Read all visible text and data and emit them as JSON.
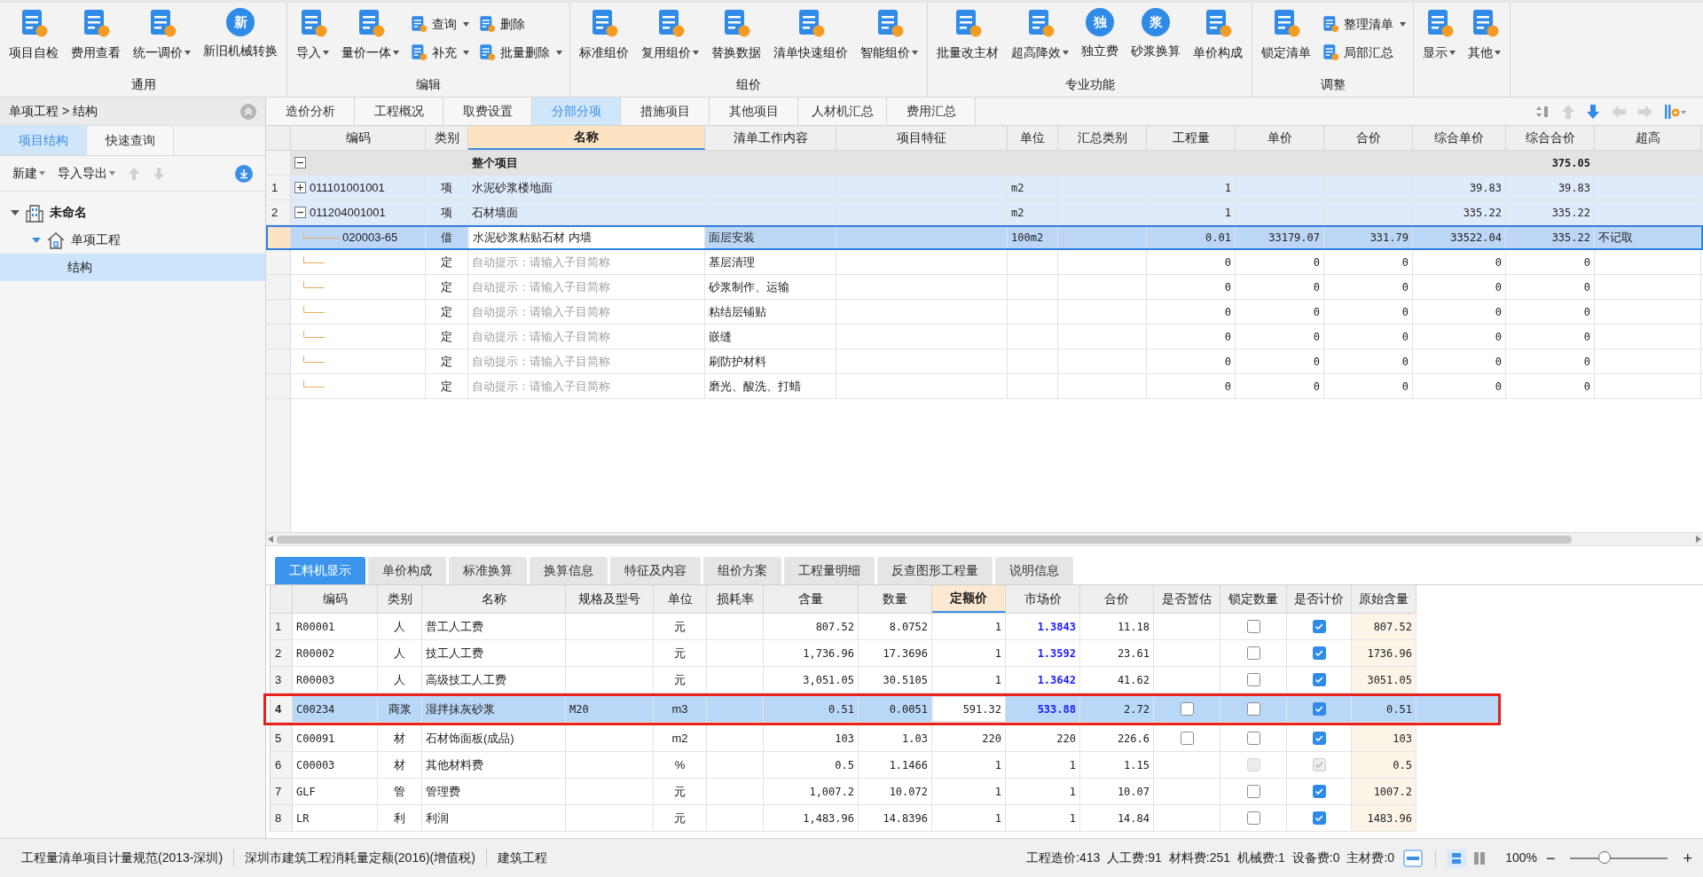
{
  "ribbon": {
    "groups": [
      {
        "label": "通用",
        "columns": [
          [
            {
              "label": "项目自检",
              "dropdown": false
            }
          ],
          [
            {
              "label": "费用查看",
              "dropdown": false
            }
          ],
          [
            {
              "label": "统一调价",
              "dropdown": true
            }
          ],
          [
            {
              "label": "新旧机械转换",
              "dropdown": false,
              "glyph": "新"
            }
          ]
        ]
      },
      {
        "label": "编辑",
        "columns": [
          [
            {
              "label": "导入",
              "dropdown": true
            }
          ],
          [
            {
              "label": "量价一体",
              "dropdown": true
            }
          ],
          [
            {
              "label": "查询",
              "dropdown": true
            },
            {
              "label": "补充",
              "dropdown": true
            }
          ],
          [
            {
              "label": "删除",
              "dropdown": false
            },
            {
              "label": "批量删除",
              "dropdown": true
            }
          ]
        ]
      },
      {
        "label": "组价",
        "columns": [
          [
            {
              "label": "标准组价",
              "dropdown": false
            }
          ],
          [
            {
              "label": "复用组价",
              "dropdown": true
            }
          ],
          [
            {
              "label": "替换数据",
              "dropdown": false
            }
          ],
          [
            {
              "label": "清单快速组价",
              "dropdown": false
            }
          ],
          [
            {
              "label": "智能组价",
              "dropdown": true
            }
          ]
        ]
      },
      {
        "label": "专业功能",
        "columns": [
          [
            {
              "label": "批量改主材",
              "dropdown": false
            }
          ],
          [
            {
              "label": "超高降效",
              "dropdown": true
            }
          ],
          [
            {
              "label": "独立费",
              "dropdown": false,
              "glyph": "独"
            }
          ],
          [
            {
              "label": "砂浆换算",
              "dropdown": false,
              "glyph": "浆"
            }
          ],
          [
            {
              "label": "单价构成",
              "dropdown": false
            }
          ]
        ]
      },
      {
        "label": "调整",
        "columns": [
          [
            {
              "label": "锁定清单",
              "dropdown": false
            }
          ],
          [
            {
              "label": "整理清单",
              "dropdown": true
            },
            {
              "label": "局部汇总",
              "dropdown": false
            }
          ]
        ]
      },
      {
        "columns": [
          [
            {
              "label": "显示",
              "dropdown": true
            }
          ],
          [
            {
              "label": "其他",
              "dropdown": true
            }
          ]
        ]
      }
    ]
  },
  "sidebar": {
    "breadcrumb": "单项工程 > 结构",
    "tabs": [
      {
        "label": "项目结构",
        "selected": true
      },
      {
        "label": "快速查询",
        "selected": false
      }
    ],
    "toolbar": [
      {
        "label": "新建",
        "dropdown": true
      },
      {
        "label": "导入导出",
        "dropdown": true
      }
    ],
    "tree": [
      {
        "label": "未命名",
        "kind": "project",
        "expanded": true,
        "selected": false,
        "children": [
          {
            "label": "单项工程",
            "kind": "unit",
            "expanded": true,
            "selected": false,
            "children": [
              {
                "label": "结构",
                "kind": "part",
                "selected": true
              }
            ]
          }
        ]
      }
    ]
  },
  "main_tabs": [
    {
      "label": "造价分析",
      "selected": false
    },
    {
      "label": "工程概况",
      "selected": false
    },
    {
      "label": "取费设置",
      "selected": false
    },
    {
      "label": "分部分项",
      "selected": true
    },
    {
      "label": "措施项目",
      "selected": false
    },
    {
      "label": "其他项目",
      "selected": false
    },
    {
      "label": "人材机汇总",
      "selected": false
    },
    {
      "label": "费用汇总",
      "selected": false
    }
  ],
  "bill_table": {
    "columns": [
      {
        "label": "编码",
        "highlighted": false
      },
      {
        "label": "类别",
        "highlighted": false
      },
      {
        "label": "名称",
        "highlighted": true
      },
      {
        "label": "清单工作内容",
        "highlighted": false
      },
      {
        "label": "项目特征",
        "highlighted": false
      },
      {
        "label": "单位",
        "highlighted": false
      },
      {
        "label": "汇总类别",
        "highlighted": false
      },
      {
        "label": "工程量",
        "highlighted": false
      },
      {
        "label": "单价",
        "highlighted": false
      },
      {
        "label": "合价",
        "highlighted": false
      },
      {
        "label": "综合单价",
        "highlighted": false
      },
      {
        "label": "综合合价",
        "highlighted": false
      },
      {
        "label": "超高",
        "highlighted": false
      }
    ],
    "rows": [
      {
        "kind": "total",
        "expanded": true,
        "selected": false,
        "name": "整个项目",
        "comp_total": "375.05"
      },
      {
        "kind": "item",
        "num": "1",
        "expanded": false,
        "selected": false,
        "code": "011101001001",
        "type": "项",
        "name": "水泥砂浆楼地面",
        "unit": "m2",
        "qty": "1",
        "comp_price": "39.83",
        "comp_total": "39.83"
      },
      {
        "kind": "item",
        "num": "2",
        "expanded": true,
        "selected": false,
        "code": "011204001001",
        "type": "项",
        "name": "石材墙面",
        "unit": "m2",
        "qty": "1",
        "comp_price": "335.22",
        "comp_total": "335.22"
      },
      {
        "kind": "quota",
        "selected": true,
        "code": "020003-65",
        "type": "借",
        "name": "水泥砂浆粘贴石材 内墙",
        "content": "面层安装",
        "unit": "100m2",
        "qty": "0.01",
        "price": "33179.07",
        "total": "331.79",
        "comp_price": "33522.04",
        "comp_total": "335.22",
        "extra": "不记取"
      },
      {
        "kind": "sub",
        "selected": false,
        "type": "定",
        "placeholder": "自动提示：请输入子目简称",
        "content": "基层清理",
        "qty": "0",
        "price": "0",
        "total": "0",
        "comp_price": "0",
        "comp_total": "0"
      },
      {
        "kind": "sub",
        "selected": false,
        "type": "定",
        "placeholder": "自动提示：请输入子目简称",
        "content": "砂浆制作、运输",
        "qty": "0",
        "price": "0",
        "total": "0",
        "comp_price": "0",
        "comp_total": "0"
      },
      {
        "kind": "sub",
        "selected": false,
        "type": "定",
        "placeholder": "自动提示：请输入子目简称",
        "content": "粘结层铺贴",
        "qty": "0",
        "price": "0",
        "total": "0",
        "comp_price": "0",
        "comp_total": "0"
      },
      {
        "kind": "sub",
        "selected": false,
        "type": "定",
        "placeholder": "自动提示：请输入子目简称",
        "content": "嵌缝",
        "qty": "0",
        "price": "0",
        "total": "0",
        "comp_price": "0",
        "comp_total": "0"
      },
      {
        "kind": "sub",
        "selected": false,
        "type": "定",
        "placeholder": "自动提示：请输入子目简称",
        "content": "刷防护材料",
        "qty": "0",
        "price": "0",
        "total": "0",
        "comp_price": "0",
        "comp_total": "0"
      },
      {
        "kind": "sub",
        "selected": false,
        "type": "定",
        "placeholder": "自动提示：请输入子目简称",
        "content": "磨光、酸洗、打蜡",
        "qty": "0",
        "price": "0",
        "total": "0",
        "comp_price": "0",
        "comp_total": "0"
      }
    ]
  },
  "detail_tabs": [
    {
      "label": "工料机显示",
      "selected": true
    },
    {
      "label": "单价构成",
      "selected": false
    },
    {
      "label": "标准换算",
      "selected": false
    },
    {
      "label": "换算信息",
      "selected": false
    },
    {
      "label": "特征及内容",
      "selected": false
    },
    {
      "label": "组价方案",
      "selected": false
    },
    {
      "label": "工程量明细",
      "selected": false
    },
    {
      "label": "反查图形工程量",
      "selected": false
    },
    {
      "label": "说明信息",
      "selected": false
    }
  ],
  "resource_table": {
    "columns": [
      {
        "label": "编码",
        "highlighted": false
      },
      {
        "label": "类别",
        "highlighted": false
      },
      {
        "label": "名称",
        "highlighted": false
      },
      {
        "label": "规格及型号",
        "highlighted": false
      },
      {
        "label": "单位",
        "highlighted": false
      },
      {
        "label": "损耗率",
        "highlighted": false
      },
      {
        "label": "含量",
        "highlighted": false
      },
      {
        "label": "数量",
        "highlighted": false
      },
      {
        "label": "定额价",
        "highlighted": true
      },
      {
        "label": "市场价",
        "highlighted": false
      },
      {
        "label": "合价",
        "highlighted": false
      },
      {
        "label": "是否暂估",
        "highlighted": false
      },
      {
        "label": "锁定数量",
        "highlighted": false
      },
      {
        "label": "是否计价",
        "highlighted": false
      },
      {
        "label": "原始含量",
        "highlighted": false
      }
    ],
    "rows": [
      {
        "num": "1",
        "selected": false,
        "outlined": false,
        "code": "R00001",
        "type": "人",
        "name": "普工人工费",
        "unit": "元",
        "content": "807.52",
        "qty": "8.0752",
        "quota_price": "1",
        "market_price": "1.3843",
        "adjusted": true,
        "total": "11.18",
        "locked": false,
        "priced": true,
        "disabled": false,
        "original": "807.52"
      },
      {
        "num": "2",
        "selected": false,
        "outlined": false,
        "code": "R00002",
        "type": "人",
        "name": "技工人工费",
        "unit": "元",
        "content": "1,736.96",
        "qty": "17.3696",
        "quota_price": "1",
        "market_price": "1.3592",
        "adjusted": true,
        "total": "23.61",
        "locked": false,
        "priced": true,
        "disabled": false,
        "original": "1736.96"
      },
      {
        "num": "3",
        "selected": false,
        "outlined": false,
        "code": "R00003",
        "type": "人",
        "name": "高级技工人工费",
        "unit": "元",
        "content": "3,051.05",
        "qty": "30.5105",
        "quota_price": "1",
        "market_price": "1.3642",
        "adjusted": true,
        "total": "41.62",
        "locked": false,
        "priced": true,
        "disabled": false,
        "original": "3051.05"
      },
      {
        "num": "4",
        "selected": true,
        "outlined": true,
        "code": "C00234",
        "type": "商浆",
        "name": "湿拌抹灰砂浆",
        "spec": "M20",
        "unit": "m3",
        "content": "0.51",
        "qty": "0.0051",
        "quota_price": "591.32",
        "market_price": "533.88",
        "adjusted": true,
        "total": "2.72",
        "estimated": false,
        "locked": false,
        "priced": true,
        "disabled": false,
        "original": "0.51"
      },
      {
        "num": "5",
        "selected": false,
        "outlined": false,
        "code": "C00091",
        "type": "材",
        "name": "石材饰面板(成品)",
        "unit": "m2",
        "content": "103",
        "qty": "1.03",
        "quota_price": "220",
        "market_price": "220",
        "adjusted": false,
        "total": "226.6",
        "estimated": false,
        "locked": false,
        "priced": true,
        "disabled": false,
        "original": "103"
      },
      {
        "num": "6",
        "selected": false,
        "outlined": false,
        "code": "C00003",
        "type": "材",
        "name": "其他材料费",
        "unit": "%",
        "content": "0.5",
        "qty": "1.1466",
        "quota_price": "1",
        "market_price": "1",
        "adjusted": false,
        "total": "1.15",
        "locked": false,
        "priced": true,
        "disabled": true,
        "original": "0.5"
      },
      {
        "num": "7",
        "selected": false,
        "outlined": false,
        "code": "GLF",
        "type": "管",
        "name": "管理费",
        "unit": "元",
        "content": "1,007.2",
        "qty": "10.072",
        "quota_price": "1",
        "market_price": "1",
        "adjusted": false,
        "total": "10.07",
        "locked": false,
        "priced": true,
        "disabled": false,
        "original": "1007.2"
      },
      {
        "num": "8",
        "selected": false,
        "outlined": false,
        "code": "LR",
        "type": "利",
        "name": "利润",
        "unit": "元",
        "content": "1,483.96",
        "qty": "14.8396",
        "quota_price": "1",
        "market_price": "1",
        "adjusted": false,
        "total": "14.84",
        "locked": false,
        "priced": true,
        "disabled": false,
        "original": "1483.96"
      }
    ]
  },
  "status_bar": {
    "left": [
      "工程量清单项目计量规范(2013-深圳)",
      "深圳市建筑工程消耗量定额(2016)(增值税)",
      "建筑工程"
    ],
    "summary": [
      "工程造价:413",
      "人工费:91",
      "材料费:251",
      "机械费:1",
      "设备费:0",
      "主材费:0"
    ],
    "zoom": {
      "value": "100%",
      "minus": "−",
      "plus": "+",
      "level": 0.35
    }
  }
}
